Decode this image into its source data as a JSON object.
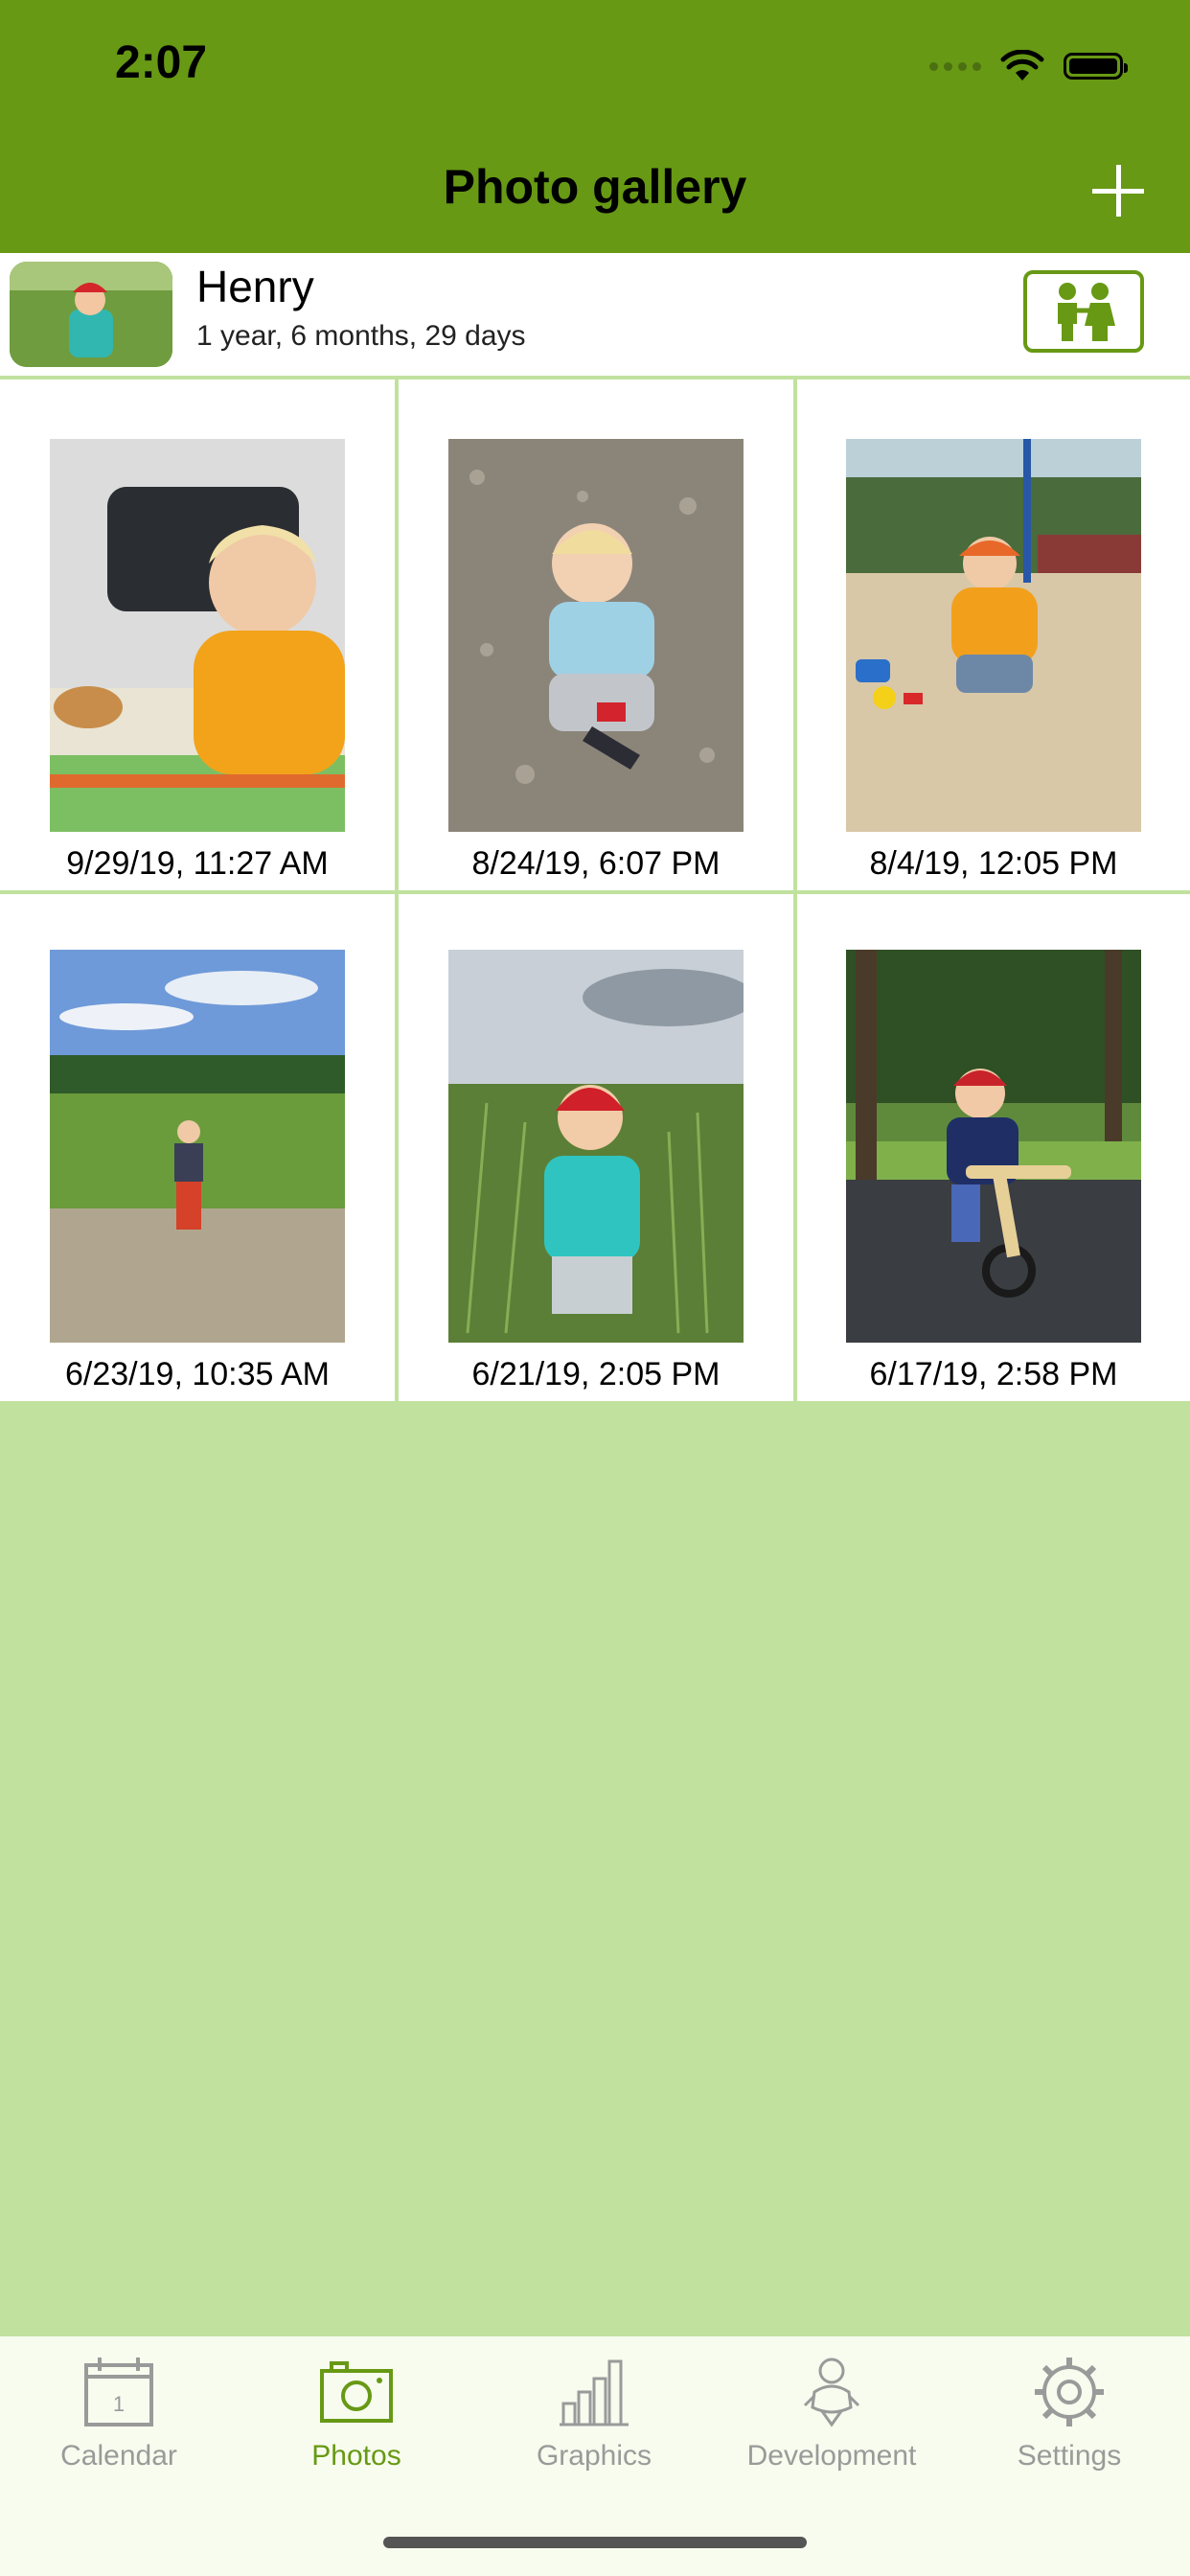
{
  "status_bar": {
    "time": "2:07"
  },
  "header": {
    "title": "Photo gallery",
    "add_icon": "plus-icon"
  },
  "profile": {
    "name": "Henry",
    "age": "1 year, 6 months, 29 days",
    "switch_icon": "children-icon"
  },
  "photos": [
    {
      "caption": "9/29/19, 11:27 AM"
    },
    {
      "caption": "8/24/19, 6:07 PM"
    },
    {
      "caption": "8/4/19, 12:05 PM"
    },
    {
      "caption": "6/23/19, 10:35 AM"
    },
    {
      "caption": "6/21/19, 2:05 PM"
    },
    {
      "caption": "6/17/19, 2:58 PM"
    }
  ],
  "tabs": [
    {
      "label": "Calendar",
      "icon": "calendar-icon",
      "calendar_day": "1"
    },
    {
      "label": "Photos",
      "icon": "camera-icon",
      "active": true
    },
    {
      "label": "Graphics",
      "icon": "bar-chart-icon"
    },
    {
      "label": "Development",
      "icon": "baby-icon"
    },
    {
      "label": "Settings",
      "icon": "gear-icon"
    }
  ],
  "colors": {
    "header": "#679914",
    "background": "#c0e29e",
    "active_tab": "#679914",
    "inactive_tab": "#9a9a9a"
  }
}
